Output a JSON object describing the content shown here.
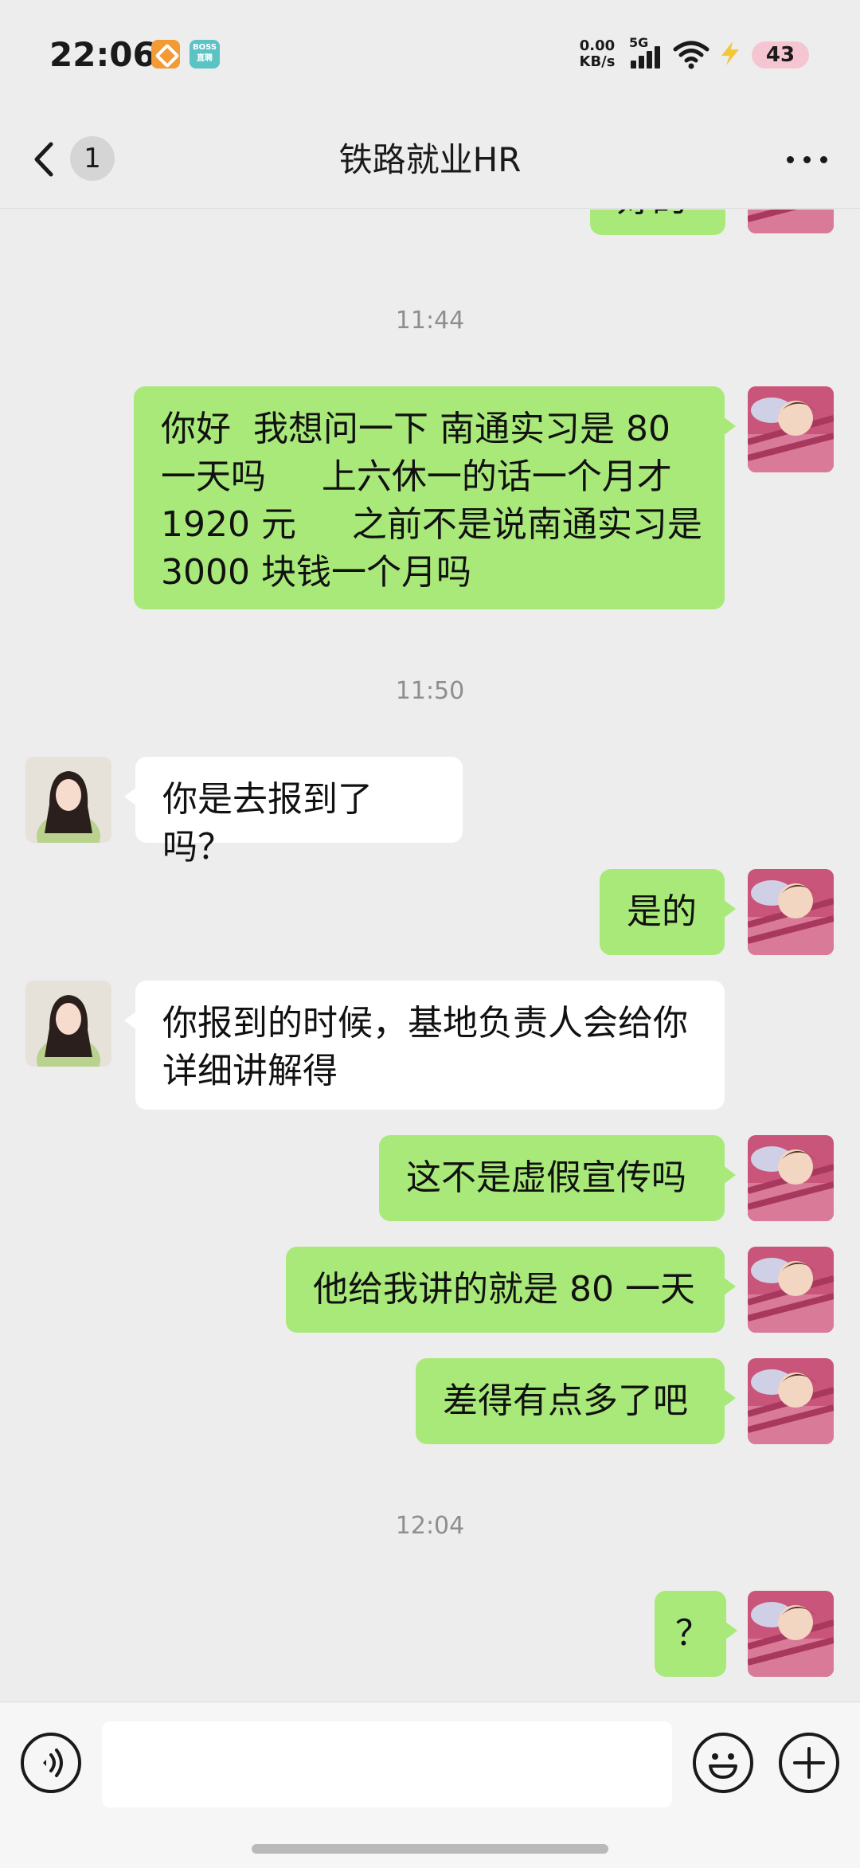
{
  "status_bar": {
    "time": "22:06",
    "app2_label": "BOSS直聘",
    "net_speed_value": "0.00",
    "net_speed_unit": "KB/s",
    "network": "5G",
    "battery": "43"
  },
  "nav": {
    "back_badge": "1",
    "title": "铁路就业HR"
  },
  "messages": [
    {
      "side": "me",
      "text": "好的"
    },
    {
      "timestamp": "11:44"
    },
    {
      "side": "me",
      "lines": [
        "你好  我想问一下 南通实习是 80",
        "一天吗     上六休一的话一个月才",
        "1920 元     之前不是说南通实习是",
        "3000 块钱一个月吗"
      ]
    },
    {
      "timestamp": "11:50"
    },
    {
      "side": "them",
      "text": "你是去报到了吗？"
    },
    {
      "side": "me",
      "text": "是的"
    },
    {
      "side": "them",
      "lines": [
        "你报到的时候，基地负责人会给你",
        "详细讲解得"
      ]
    },
    {
      "side": "me",
      "text": "这不是虚假宣传吗"
    },
    {
      "side": "me",
      "text": "他给我讲的就是 80 一天"
    },
    {
      "side": "me",
      "text": "差得有点多了吧"
    },
    {
      "timestamp": "12:04"
    },
    {
      "side": "me",
      "text": "？"
    }
  ],
  "input": {
    "value": ""
  },
  "colors": {
    "my_bubble": "#a9e97a",
    "their_bubble": "#ffffff",
    "background": "#ededed"
  }
}
